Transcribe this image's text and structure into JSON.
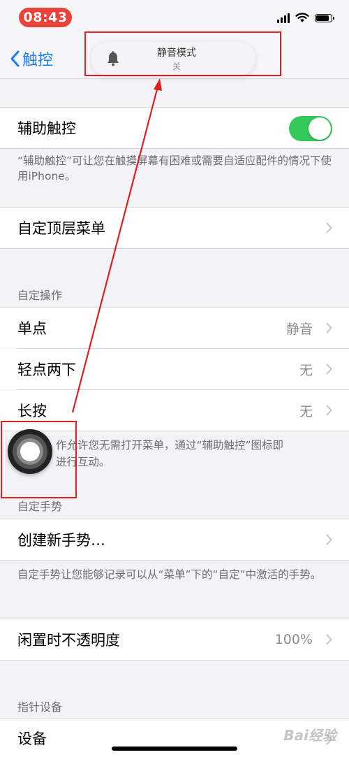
{
  "status_bar": {
    "time": "08:43",
    "battery_level": 0.85
  },
  "nav": {
    "back_label": "触控"
  },
  "hud": {
    "title": "静音模式",
    "subtitle": "关",
    "icon": "bell-icon"
  },
  "assistive_touch": {
    "label": "辅助触控",
    "toggle_on": true,
    "footer": "“辅助触控”可让您在触摸屏幕有困难或需要自适应配件的情况下使用iPhone。"
  },
  "top_menu": {
    "label": "自定顶层菜单"
  },
  "custom_actions": {
    "header": "自定操作",
    "rows": [
      {
        "label": "单点",
        "value": "静音"
      },
      {
        "label": "轻点两下",
        "value": "无"
      },
      {
        "label": "长按",
        "value": "无"
      }
    ],
    "footer_line1": "作允许您无需打开菜单，通过“辅助触控”图标即",
    "footer_line2": "进行互动。"
  },
  "custom_gestures": {
    "header": "自定手势",
    "create_label": "创建新手势…",
    "footer": "自定手势让您能够记录可以从“菜单”下的“自定”中激活的手势。"
  },
  "idle_opacity": {
    "label": "闲置时不透明度",
    "value": "100%"
  },
  "pointer_devices": {
    "header": "指针设备",
    "devices_label": "设备"
  },
  "watermark": "Bai经验",
  "colors": {
    "accent": "#1a7cf5",
    "toggle_on": "#34c759",
    "annotation": "#e02020",
    "time_pill": "#e8423a"
  }
}
